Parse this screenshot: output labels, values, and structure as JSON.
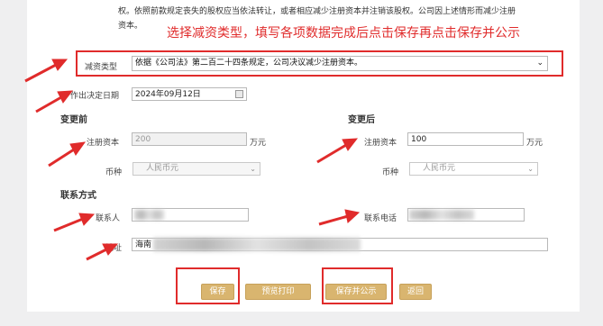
{
  "intro_text": {
    "line1": "权。依照前款规定丧失的股权应当依法转让，或者相应减少注册资本并注销该股权。公司因上述情形而减少注册",
    "line2": "资本。"
  },
  "instruction_text": "选择减资类型，填写各项数据完成后点击保存再点击保存并公示",
  "reduction_type": {
    "label": "减资类型",
    "value": "依据《公司法》第二百二十四条规定，公司决议减少注册资本。"
  },
  "decision_date": {
    "label": "作出决定日期",
    "value": "2024年09月12日",
    "icon": "calendar-icon"
  },
  "before": {
    "title": "变更前",
    "capital_label": "注册资本",
    "capital_value": "200",
    "unit": "万元",
    "currency_label": "币种",
    "currency_value": "人民币元"
  },
  "after": {
    "title": "变更后",
    "capital_label": "注册资本",
    "capital_value": "100",
    "unit": "万元",
    "currency_label": "币种",
    "currency_value": "人民币元"
  },
  "contact": {
    "title": "联系方式",
    "person_label": "联系人",
    "phone_label": "联系电话",
    "address_label": "地址",
    "address_value": "海南"
  },
  "buttons": {
    "save": "保存",
    "preview_print": "预览打印",
    "save_publish": "保存并公示",
    "back": "返回"
  },
  "colors": {
    "annotation_red": "#e02b2b",
    "button_gold": "#d9b56f"
  }
}
